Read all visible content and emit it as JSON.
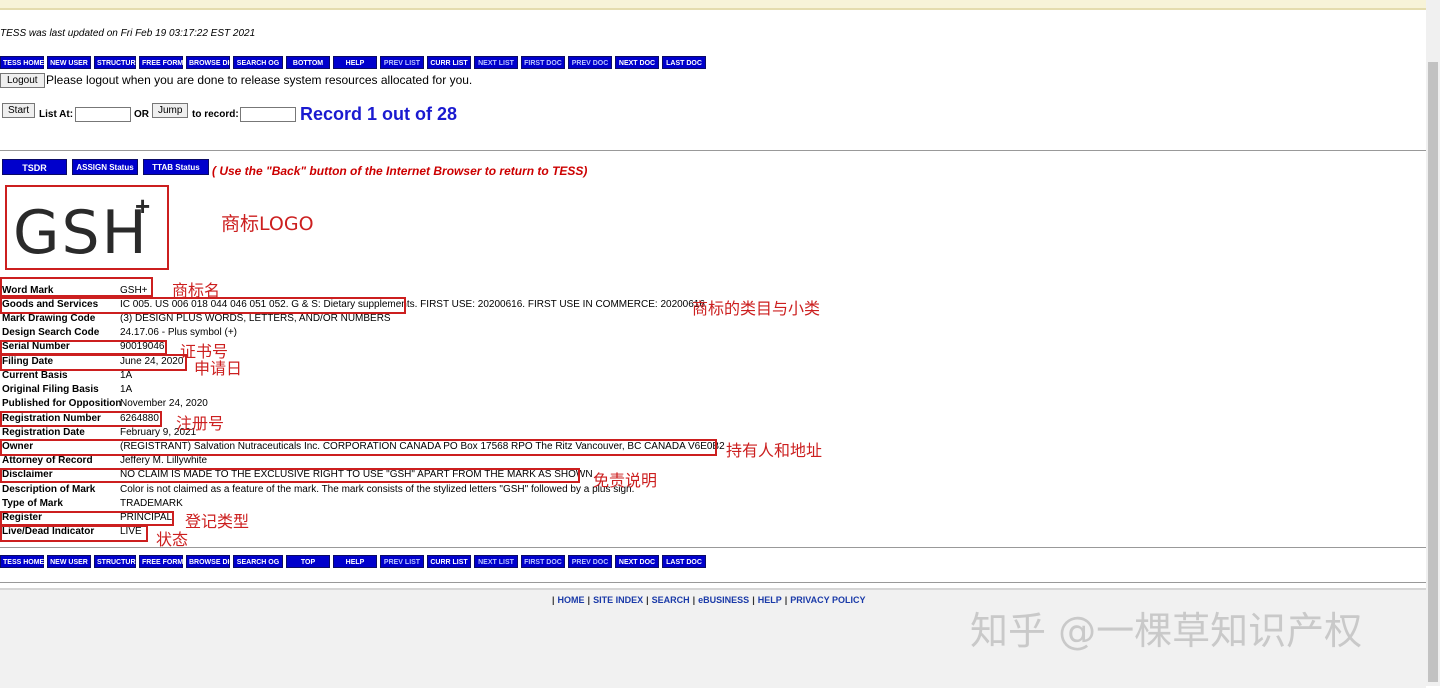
{
  "update_notice": "TESS was last updated on Fri Feb 19 03:17:22 EST 2021",
  "nav_top": [
    {
      "label": "TESS HOME",
      "dim": false
    },
    {
      "label": "NEW USER",
      "dim": false
    },
    {
      "label": "STRUCTURED",
      "dim": false
    },
    {
      "label": "FREE FORM",
      "dim": false
    },
    {
      "label": "BROWSE DICT",
      "dim": false
    },
    {
      "label": "SEARCH OG",
      "dim": false
    },
    {
      "label": "BOTTOM",
      "dim": false
    },
    {
      "label": "HELP",
      "dim": false
    },
    {
      "label": "PREV LIST",
      "dim": true
    },
    {
      "label": "CURR LIST",
      "dim": false
    },
    {
      "label": "NEXT LIST",
      "dim": true
    },
    {
      "label": "FIRST DOC",
      "dim": true
    },
    {
      "label": "PREV DOC",
      "dim": true
    },
    {
      "label": "NEXT DOC",
      "dim": false
    },
    {
      "label": "LAST DOC",
      "dim": false
    }
  ],
  "nav_bottom": [
    {
      "label": "TESS HOME",
      "dim": false
    },
    {
      "label": "NEW USER",
      "dim": false
    },
    {
      "label": "STRUCTURED",
      "dim": false
    },
    {
      "label": "FREE FORM",
      "dim": false
    },
    {
      "label": "BROWSE DICT",
      "dim": false
    },
    {
      "label": "SEARCH OG",
      "dim": false
    },
    {
      "label": "TOP",
      "dim": false
    },
    {
      "label": "HELP",
      "dim": false
    },
    {
      "label": "PREV LIST",
      "dim": true
    },
    {
      "label": "CURR LIST",
      "dim": false
    },
    {
      "label": "NEXT LIST",
      "dim": true
    },
    {
      "label": "FIRST DOC",
      "dim": true
    },
    {
      "label": "PREV DOC",
      "dim": true
    },
    {
      "label": "NEXT DOC",
      "dim": false
    },
    {
      "label": "LAST DOC",
      "dim": false
    }
  ],
  "logout": {
    "button": "Logout",
    "message": "Please logout when you are done to release system resources allocated for you."
  },
  "search_form": {
    "start_button": "Start",
    "list_at_label": "List At:",
    "or_label": "OR",
    "jump_button": "Jump",
    "to_record_label": "to record:",
    "list_at_value": "",
    "record_value": ""
  },
  "record_status": "Record 1 out of 28",
  "status_buttons": {
    "tsdr": "TSDR",
    "assign": "ASSIGN Status",
    "ttab": "TTAB Status"
  },
  "back_note": "( Use the \"Back\" button of the Internet Browser to return to TESS)",
  "logo": {
    "text": "GSH",
    "plus": "+"
  },
  "annotations": {
    "logo": "商标LOGO",
    "word_mark": "商标名",
    "goods": "商标的类目与小类",
    "serial": "证书号",
    "filing": "申请日",
    "registration": "注册号",
    "owner": "持有人和地址",
    "disclaimer": "免责说明",
    "register": "登记类型",
    "live_dead": "状态"
  },
  "fields": [
    {
      "label": "Word Mark",
      "value": "GSH+"
    },
    {
      "label": "Goods and Services",
      "value": "IC 005. US 006 018 044 046 051 052. G & S: Dietary supplements. FIRST USE: 20200616. FIRST USE IN COMMERCE: 20200616"
    },
    {
      "label": "Mark Drawing Code",
      "value": "(3) DESIGN PLUS WORDS, LETTERS, AND/OR NUMBERS"
    },
    {
      "label": "Design Search Code",
      "value": "24.17.06 - Plus symbol (+)"
    },
    {
      "label": "Serial Number",
      "value": "90019046"
    },
    {
      "label": "Filing Date",
      "value": "June 24, 2020"
    },
    {
      "label": "Current Basis",
      "value": "1A"
    },
    {
      "label": "Original Filing Basis",
      "value": "1A"
    },
    {
      "label": "Published for Opposition",
      "value": "November 24, 2020"
    },
    {
      "label": "Registration Number",
      "value": "6264880"
    },
    {
      "label": "Registration Date",
      "value": "February 9, 2021"
    },
    {
      "label": "Owner",
      "value": "(REGISTRANT) Salvation Nutraceuticals Inc. CORPORATION CANADA PO Box 17568 RPO The Ritz Vancouver, BC CANADA V6E0B2"
    },
    {
      "label": "Attorney of Record",
      "value": "Jeffery M. Lillywhite"
    },
    {
      "label": "Disclaimer",
      "value": "NO CLAIM IS MADE TO THE EXCLUSIVE RIGHT TO USE \"GSH\" APART FROM THE MARK AS SHOWN"
    },
    {
      "label": "Description of Mark",
      "value": "Color is not claimed as a feature of the mark. The mark consists of the stylized letters \"GSH\" followed by a plus sign."
    },
    {
      "label": "Type of Mark",
      "value": "TRADEMARK"
    },
    {
      "label": "Register",
      "value": "PRINCIPAL"
    },
    {
      "label": "Live/Dead Indicator",
      "value": "LIVE"
    }
  ],
  "footer_links": [
    "HOME",
    "SITE INDEX",
    "SEARCH",
    "eBUSINESS",
    "HELP",
    "PRIVACY POLICY"
  ],
  "watermark": "知乎 @一棵草知识产权"
}
